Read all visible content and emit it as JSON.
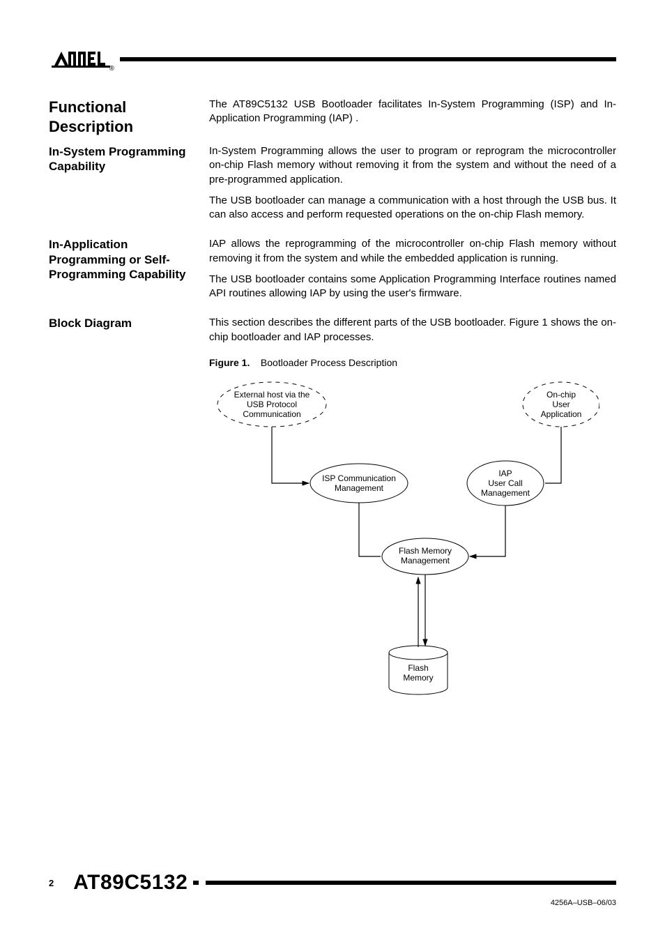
{
  "logo_text": "AIMEL",
  "sections": {
    "functional": {
      "heading": "Functional Description",
      "p1": "The AT89C5132 USB Bootloader facilitates In-System Programming (ISP) and In-Application Programming (IAP) ."
    },
    "isp": {
      "heading": "In-System Programming Capability",
      "p1": "In-System Programming allows the user to program or reprogram the microcontroller on-chip Flash memory without removing it from the system and without the need of a pre-programmed application.",
      "p2": "The USB bootloader can manage a communication with a host through the USB bus. It can also access and perform requested operations on the on-chip Flash memory."
    },
    "iap": {
      "heading": "In-Application Programming or Self-Programming Capability",
      "p1": "IAP allows the reprogramming of the microcontroller on-chip Flash memory without removing it from the system and while the embedded application is running.",
      "p2": "The USB bootloader contains some Application Programming Interface routines named API routines allowing IAP by using the user's firmware."
    },
    "block": {
      "heading": "Block Diagram",
      "p1": "This section describes the different parts of the USB bootloader. Figure 1 shows the on-chip bootloader and IAP processes."
    }
  },
  "figure": {
    "label": "Figure 1.",
    "caption": "Bootloader Process Description",
    "nodes": {
      "external_host_l1": "External host via the",
      "external_host_l2": "USB Protocol",
      "external_host_l3": "Communication",
      "onchip_l1": "On-chip",
      "onchip_l2": "User",
      "onchip_l3": "Application",
      "isp_l1": "ISP Communication",
      "isp_l2": "Management",
      "iap_l1": "IAP",
      "iap_l2": "User Call",
      "iap_l3": "Management",
      "flashmgmt_l1": "Flash Memory",
      "flashmgmt_l2": "Management",
      "flashmem_l1": "Flash",
      "flashmem_l2": "Memory"
    }
  },
  "footer": {
    "page_number": "2",
    "chip": "AT89C5132",
    "doc_id": "4256A–USB–06/03"
  }
}
